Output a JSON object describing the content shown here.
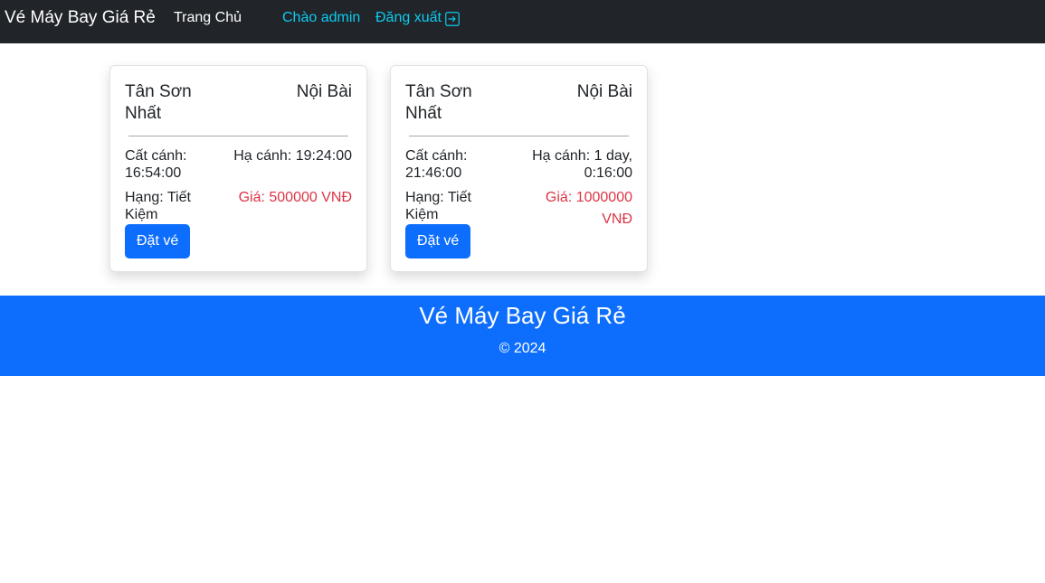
{
  "navbar": {
    "brand": "Vé Máy Bay Giá Rẻ",
    "home": "Trang Chủ",
    "greeting": "Chào admin",
    "logout": "Đăng xuất",
    "logout_icon": "box-arrow-right-icon"
  },
  "flights": [
    {
      "from": "Tân Sơn Nhất",
      "to": "Nội Bài",
      "departure": "Cất cánh: 16:54:00",
      "arrival": "Hạ cánh: 19:24:00",
      "seat_class": "Hạng: Tiết Kiệm",
      "price": "Giá: 500000 VNĐ",
      "button": "Đặt vé"
    },
    {
      "from": "Tân Sơn Nhất",
      "to": "Nội Bài",
      "departure": "Cất cánh: 21:46:00",
      "arrival": "Hạ cánh: 1 day, 0:16:00",
      "seat_class": "Hạng: Tiết Kiệm",
      "price": "Giá: 1000000 VNĐ",
      "button": "Đặt vé"
    }
  ],
  "footer": {
    "title": "Vé Máy Bay Giá Rẻ",
    "copyright": "© 2024"
  },
  "colors": {
    "navbar_bg": "#212529",
    "link_cyan": "#0dcaf0",
    "primary": "#0d6efd",
    "price_red": "#dc3545"
  }
}
